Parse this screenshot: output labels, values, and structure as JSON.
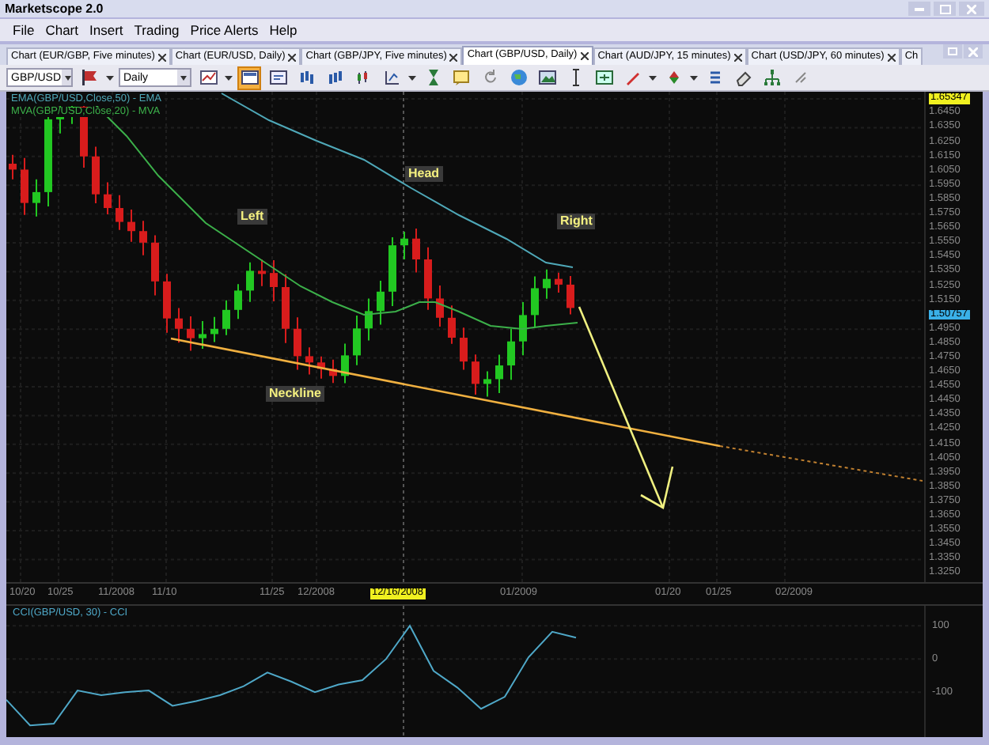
{
  "window": {
    "title": "Marketscope 2.0"
  },
  "menu": [
    "File",
    "Chart",
    "Insert",
    "Trading",
    "Price Alerts",
    "Help"
  ],
  "tabs": [
    {
      "label": "Chart (EUR/GBP, Five minutes)",
      "selected": false
    },
    {
      "label": "Chart (EUR/USD, Daily)",
      "selected": false
    },
    {
      "label": "Chart (GBP/JPY, Five minutes)",
      "selected": false
    },
    {
      "label": "Chart (GBP/USD, Daily)",
      "selected": true
    },
    {
      "label": "Chart (AUD/JPY, 15 minutes)",
      "selected": false
    },
    {
      "label": "Chart (USD/JPY, 60 minutes)",
      "selected": false
    },
    {
      "label": "Ch",
      "selected": false
    }
  ],
  "toolbar": {
    "symbol": "GBP/USD",
    "period": "Daily",
    "tools": [
      {
        "kind": "button",
        "active": false
      },
      {
        "kind": "caret",
        "active": false
      },
      {
        "kind": "button",
        "active": false
      },
      {
        "kind": "caret",
        "active": false
      },
      {
        "kind": "button",
        "active": true
      },
      {
        "kind": "button",
        "active": false
      },
      {
        "kind": "button",
        "active": false
      },
      {
        "kind": "button",
        "active": false
      },
      {
        "kind": "button",
        "active": false
      },
      {
        "kind": "button",
        "active": false
      },
      {
        "kind": "caret",
        "active": false
      },
      {
        "kind": "button",
        "active": false
      },
      {
        "kind": "button",
        "active": false
      },
      {
        "kind": "button",
        "active": false
      },
      {
        "kind": "button",
        "active": false
      },
      {
        "kind": "button",
        "active": false
      },
      {
        "kind": "button",
        "active": false
      },
      {
        "kind": "button",
        "active": false
      },
      {
        "kind": "button",
        "active": false
      },
      {
        "kind": "caret",
        "active": false
      },
      {
        "kind": "button",
        "active": false
      },
      {
        "kind": "caret",
        "active": false
      },
      {
        "kind": "button",
        "active": false
      },
      {
        "kind": "button",
        "active": false
      },
      {
        "kind": "button",
        "active": false
      },
      {
        "kind": "button",
        "active": false
      }
    ]
  },
  "chart": {
    "legends": [
      {
        "text": "EMA(GBP/USD,Close,50) - EMA",
        "color": "#4fa8b8"
      },
      {
        "text": "MVA(GBP/USD,Close,20) - MVA",
        "color": "#3cb04a"
      }
    ],
    "annotations": [
      "Left",
      "Head",
      "Right",
      "Neckline"
    ],
    "price_axis": [
      {
        "text": "1.65347",
        "kind": "high"
      },
      {
        "text": "1.6450",
        "kind": "tick"
      },
      {
        "text": "1.6350",
        "kind": "tick"
      },
      {
        "text": "1.6250",
        "kind": "tick"
      },
      {
        "text": "1.6150",
        "kind": "tick"
      },
      {
        "text": "1.6050",
        "kind": "tick"
      },
      {
        "text": "1.5950",
        "kind": "tick"
      },
      {
        "text": "1.5850",
        "kind": "tick"
      },
      {
        "text": "1.5750",
        "kind": "tick"
      },
      {
        "text": "1.5650",
        "kind": "tick"
      },
      {
        "text": "1.5550",
        "kind": "tick"
      },
      {
        "text": "1.5450",
        "kind": "tick"
      },
      {
        "text": "1.5350",
        "kind": "tick"
      },
      {
        "text": "1.5250",
        "kind": "tick"
      },
      {
        "text": "1.5150",
        "kind": "tick"
      },
      {
        "text": "1.50757",
        "kind": "current"
      },
      {
        "text": "1.4950",
        "kind": "tick"
      },
      {
        "text": "1.4850",
        "kind": "tick"
      },
      {
        "text": "1.4750",
        "kind": "tick"
      },
      {
        "text": "1.4650",
        "kind": "tick"
      },
      {
        "text": "1.4550",
        "kind": "tick"
      },
      {
        "text": "1.4450",
        "kind": "tick"
      },
      {
        "text": "1.4350",
        "kind": "tick"
      },
      {
        "text": "1.4250",
        "kind": "tick"
      },
      {
        "text": "1.4150",
        "kind": "tick"
      },
      {
        "text": "1.4050",
        "kind": "tick"
      },
      {
        "text": "1.3950",
        "kind": "tick"
      },
      {
        "text": "1.3850",
        "kind": "tick"
      },
      {
        "text": "1.3750",
        "kind": "tick"
      },
      {
        "text": "1.3650",
        "kind": "tick"
      },
      {
        "text": "1.3550",
        "kind": "tick"
      },
      {
        "text": "1.3450",
        "kind": "tick"
      },
      {
        "text": "1.3350",
        "kind": "tick"
      },
      {
        "text": "1.3250",
        "kind": "tick"
      }
    ],
    "date_axis": [
      {
        "text": "10/20",
        "highlighted": false
      },
      {
        "text": "10/25",
        "highlighted": false
      },
      {
        "text": "11/2008",
        "highlighted": false
      },
      {
        "text": "11/10",
        "highlighted": false
      },
      {
        "text": "11/25",
        "highlighted": false
      },
      {
        "text": "12/2008",
        "highlighted": false
      },
      {
        "text": "12/16/2008",
        "highlighted": true
      },
      {
        "text": "01/2009",
        "highlighted": false
      },
      {
        "text": "01/20",
        "highlighted": false
      },
      {
        "text": "01/25",
        "highlighted": false
      },
      {
        "text": "02/2009",
        "highlighted": false
      }
    ]
  },
  "indicator": {
    "legend": "CCI(GBP/USD, 30) - CCI",
    "chart_data": {
      "type": "line",
      "ylim": [
        -240,
        160
      ],
      "grid": true,
      "yticks": [
        -100,
        0,
        100
      ],
      "series": [
        {
          "color": "#4fa8c8",
          "values": [
            -123,
            -200,
            -195,
            -95,
            -109,
            -100,
            -95,
            -141,
            -127,
            -109,
            -82,
            -41,
            -68,
            -100,
            -77,
            -64,
            0,
            100,
            -36,
            -86,
            -150,
            -114,
            5,
            82,
            64
          ]
        }
      ]
    }
  }
}
